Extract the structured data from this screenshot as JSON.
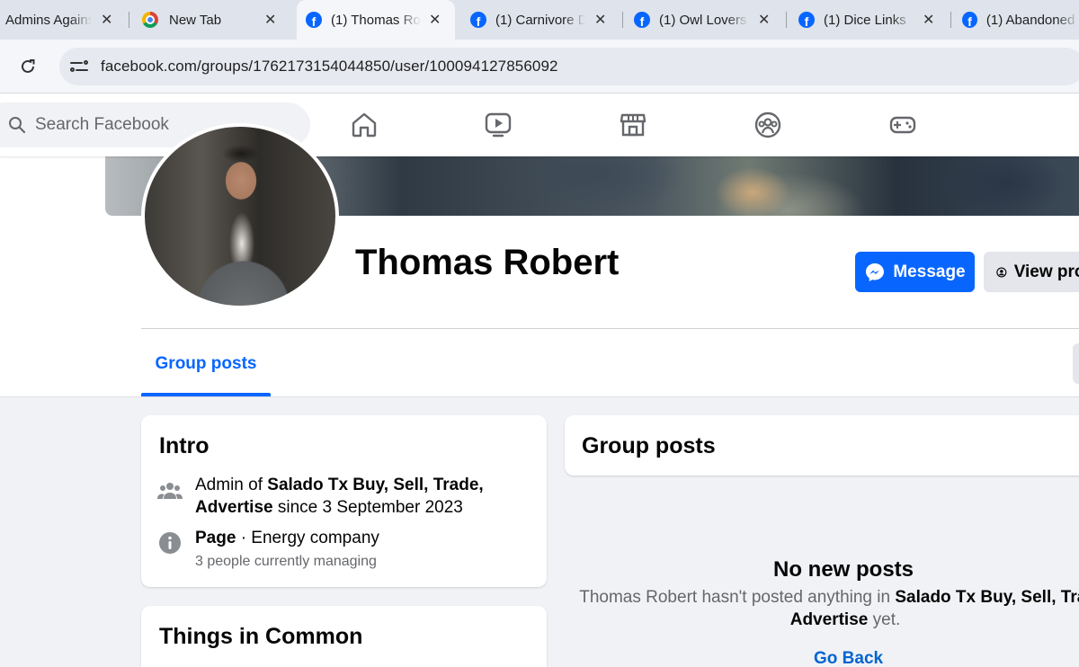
{
  "browser": {
    "tabs": [
      {
        "title": "Admins Against",
        "favicon": "generic"
      },
      {
        "title": "New Tab",
        "favicon": "chrome-icon"
      },
      {
        "title": "(1) Thomas Ro",
        "favicon": "facebook-icon"
      },
      {
        "title": "(1) Carnivore D",
        "favicon": "facebook-icon"
      },
      {
        "title": "(1) Owl Lovers",
        "favicon": "facebook-icon"
      },
      {
        "title": "(1) Dice Links",
        "favicon": "facebook-icon"
      },
      {
        "title": "(1) Abandoned",
        "favicon": "facebook-icon"
      }
    ],
    "close_glyph": "✕",
    "url": "facebook.com/groups/1762173154044850/user/100094127856092"
  },
  "header": {
    "search_placeholder": "Search Facebook",
    "nav_icons": [
      "home-icon",
      "watch-icon",
      "marketplace-icon",
      "groups-icon",
      "gaming-icon"
    ]
  },
  "profile": {
    "name": "Thomas Robert",
    "message_label": "Message",
    "view_profile_label": "View profile",
    "tab_label": "Group posts"
  },
  "intro": {
    "title": "Intro",
    "admin_prefix": "Admin of ",
    "admin_group": "Salado Tx Buy, Sell, Trade,",
    "admin_group_cont": "Advertise",
    "admin_suffix": " since 3 September 2023",
    "page_label": "Page",
    "page_category": " · Energy company",
    "page_sub": "3 people currently managing"
  },
  "things_in_common": {
    "title": "Things in Common"
  },
  "group_posts": {
    "title": "Group posts",
    "empty_title": "No new posts",
    "empty_prefix": "Thomas Robert hasn't posted anything in ",
    "empty_group": "Salado Tx Buy, Sell, Trade,",
    "empty_group_cont": "Advertise",
    "empty_suffix": " yet.",
    "go_back": "Go Back"
  },
  "colors": {
    "accent": "#0866ff",
    "background": "#f0f2f5",
    "muted_text": "#65676b"
  }
}
